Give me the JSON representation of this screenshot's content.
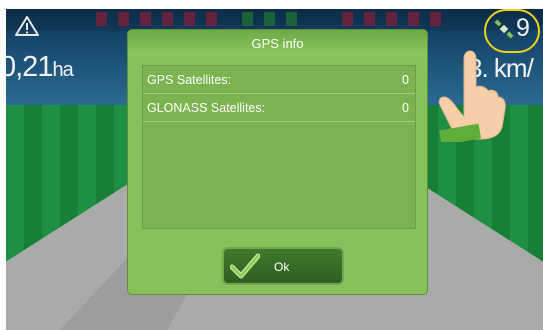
{
  "status": {
    "area_value": "0,21",
    "area_unit": "ha",
    "satellite_count": "9",
    "speed_text": "3.  km/"
  },
  "dialog": {
    "title": "GPS info",
    "rows": [
      {
        "label": "GPS Satellites:",
        "value": "0"
      },
      {
        "label": "GLONASS Satellites:",
        "value": "0"
      }
    ],
    "ok_label": "Ok"
  },
  "icons": {
    "warning": "warning-triangle-icon",
    "satellite": "satellite-icon",
    "check": "checkmark-icon",
    "hand": "pointing-hand-icon"
  },
  "colors": {
    "dialog_bg": "#86c15a",
    "button_bg": "#2f5e20",
    "highlight_ring": "#f0d21a"
  }
}
